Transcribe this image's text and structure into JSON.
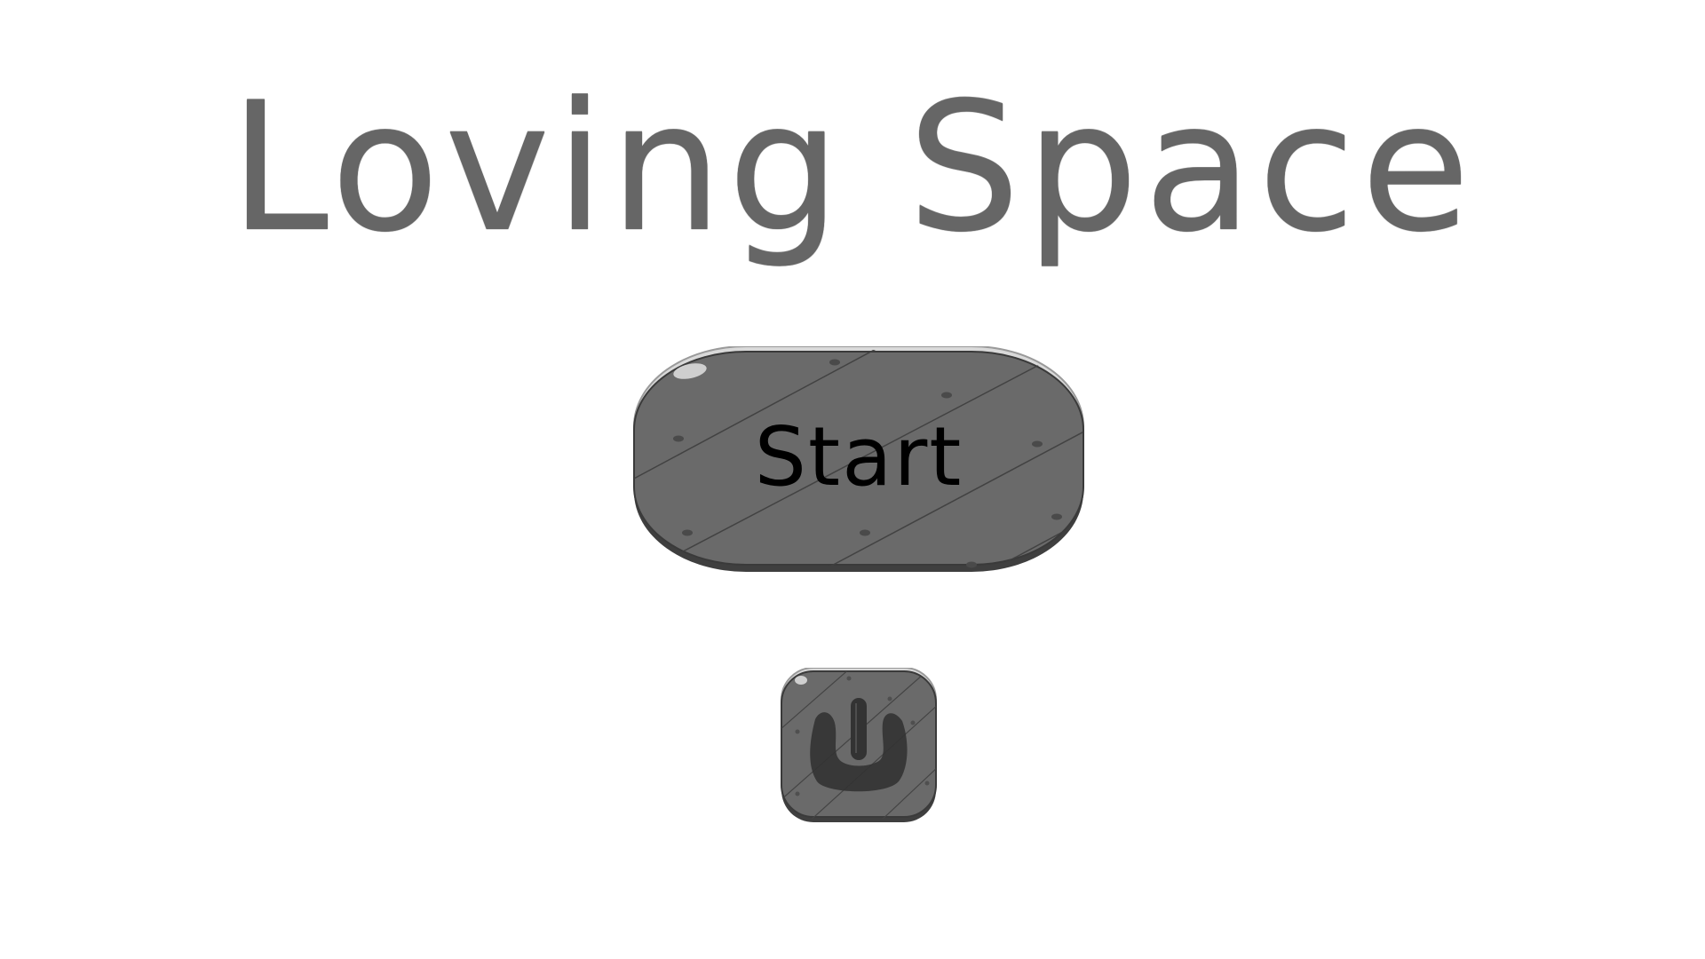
{
  "game": {
    "title": "Loving Space"
  },
  "menu": {
    "start_label": "Start",
    "quit_icon": "power-icon"
  },
  "colors": {
    "background": "#ffffff",
    "title": "#666666",
    "button_face": "#6a6a6a",
    "button_edge": "#3f3f3f",
    "button_label": "#000000",
    "power_symbol": "#333333"
  }
}
